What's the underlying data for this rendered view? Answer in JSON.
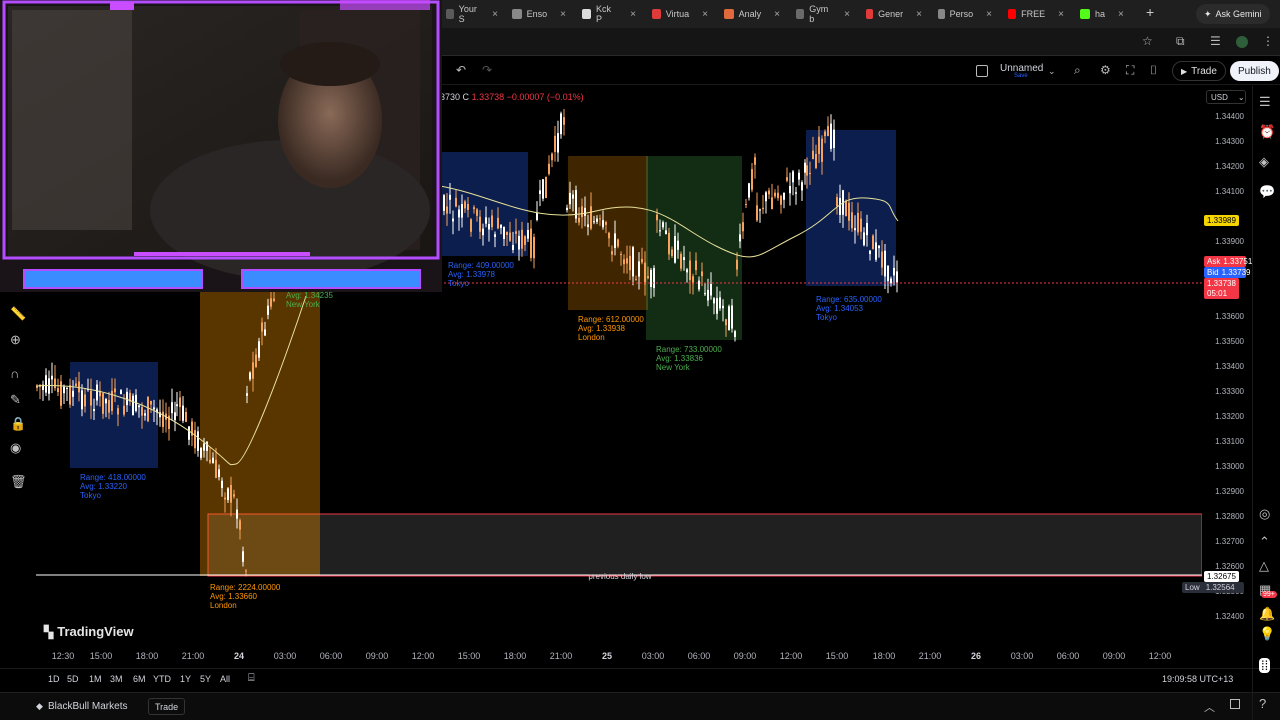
{
  "browser": {
    "tabs": [
      {
        "label": "Your S",
        "color": "#5a5a5a"
      },
      {
        "label": "Enso",
        "color": "#888888"
      },
      {
        "label": "Kck P",
        "color": "#dcdcdc"
      },
      {
        "label": "Virtua",
        "color": "#e03b3b"
      },
      {
        "label": "Analy",
        "color": "#e06a3b"
      },
      {
        "label": "Gym b",
        "color": "#6a6a6a"
      },
      {
        "label": "Gener",
        "color": "#e03b3b"
      },
      {
        "label": "Perso",
        "color": "#888888"
      },
      {
        "label": "FREE",
        "color": "#ff0000"
      },
      {
        "label": "ha",
        "color": "#53fc18"
      }
    ],
    "new_tab": "+",
    "ask_gemini": "Ask Gemini"
  },
  "toolbar": {
    "layout_name": "Unnamed",
    "layout_status": "Save",
    "trade": "Trade",
    "publish": "Publish"
  },
  "legend": {
    "prefix": "3730",
    "close_label": "C",
    "close": "1.33738",
    "change": "−0.00007 (−0.01%)"
  },
  "price_axis": {
    "currency": "USD",
    "ticks": [
      "1.34400",
      "1.34300",
      "1.34200",
      "1.34100",
      "1.33900",
      "1.33600",
      "1.33500",
      "1.33400",
      "1.33300",
      "1.33200",
      "1.33100",
      "1.33000",
      "1.32900",
      "1.32800",
      "1.32700",
      "1.32600",
      "1.32500",
      "1.32400"
    ],
    "labels": {
      "ma_value": "1.33989",
      "ask_text": "Ask",
      "ask_value": "1.33751",
      "bid_text": "Bid",
      "bid_value": "1.33739",
      "last_value": "1.33738",
      "countdown": "05:01",
      "pdl_value": "1.32675",
      "low_text": "Low",
      "low_value": "1.32564"
    }
  },
  "sessions": [
    {
      "range": "Range: 409.00000",
      "avg": "Avg: 1.33978",
      "name": "Tokyo",
      "color": "#2962ff"
    },
    {
      "range": "Range: 612.00000",
      "avg": "Avg: 1.33938",
      "name": "London",
      "color": "#ff9800"
    },
    {
      "range": "Range: 733.00000",
      "avg": "Avg: 1.33836",
      "name": "New York",
      "color": "#4caf50"
    },
    {
      "range": "Range: 635.00000",
      "avg": "Avg: 1.34053",
      "name": "Tokyo",
      "color": "#2962ff"
    },
    {
      "range": "Range: 418.00000",
      "avg": "Avg: 1.33220",
      "name": "Tokyo",
      "color": "#2962ff"
    },
    {
      "range": "Range: 2224.00000",
      "avg": "Avg: 1.33660",
      "name": "London",
      "color": "#ff9800"
    },
    {
      "range": "",
      "avg": "Avg: 1.34235",
      "name": "New York",
      "color": "#4caf50"
    }
  ],
  "annotations": {
    "previous_daily_low": "previous daily low"
  },
  "time_axis": {
    "ticks": [
      {
        "label": "12:30",
        "bold": false
      },
      {
        "label": "15:00",
        "bold": false
      },
      {
        "label": "18:00",
        "bold": false
      },
      {
        "label": "21:00",
        "bold": false
      },
      {
        "label": "24",
        "bold": true
      },
      {
        "label": "03:00",
        "bold": false
      },
      {
        "label": "06:00",
        "bold": false
      },
      {
        "label": "09:00",
        "bold": false
      },
      {
        "label": "12:00",
        "bold": false
      },
      {
        "label": "15:00",
        "bold": false
      },
      {
        "label": "18:00",
        "bold": false
      },
      {
        "label": "21:00",
        "bold": false
      },
      {
        "label": "25",
        "bold": true
      },
      {
        "label": "03:00",
        "bold": false
      },
      {
        "label": "06:00",
        "bold": false
      },
      {
        "label": "09:00",
        "bold": false
      },
      {
        "label": "12:00",
        "bold": false
      },
      {
        "label": "15:00",
        "bold": false
      },
      {
        "label": "18:00",
        "bold": false
      },
      {
        "label": "21:00",
        "bold": false
      },
      {
        "label": "26",
        "bold": true
      },
      {
        "label": "03:00",
        "bold": false
      },
      {
        "label": "06:00",
        "bold": false
      },
      {
        "label": "09:00",
        "bold": false
      },
      {
        "label": "12:00",
        "bold": false
      }
    ]
  },
  "periods": [
    "1D",
    "5D",
    "1M",
    "3M",
    "6M",
    "YTD",
    "1Y",
    "5Y",
    "All"
  ],
  "clock": "19:09:58 UTC+13",
  "footer": {
    "broker": "BlackBull Markets",
    "trade": "Trade"
  },
  "brand": {
    "logo_text": "TradingView"
  },
  "badge": {
    "count": "99+"
  },
  "colors": {
    "up": "#ffffff",
    "down": "#f7a35c",
    "ma": "#e8e29a",
    "tokyo": "#2962ff",
    "london": "#ff9800",
    "newyork": "#4caf50",
    "pdl_zone": "#f23645"
  }
}
